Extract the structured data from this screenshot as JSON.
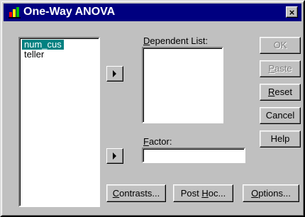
{
  "window": {
    "title": "One-Way ANOVA",
    "close_label": "×"
  },
  "variables": {
    "items": [
      {
        "label": "num_cus",
        "selected": true
      },
      {
        "label": "teller",
        "selected": false
      }
    ]
  },
  "dependent_list": {
    "label_prefix": "",
    "label_hotkey": "D",
    "label_rest": "ependent List:"
  },
  "factor": {
    "label_hotkey": "F",
    "label_rest": "actor:",
    "value": ""
  },
  "buttons": {
    "ok": "OK",
    "paste_hotkey": "P",
    "paste_rest": "aste",
    "reset_hotkey": "R",
    "reset_rest": "eset",
    "cancel": "Cancel",
    "help": "Help",
    "contrasts_hotkey": "C",
    "contrasts_rest": "ontrasts...",
    "posthoc_prefix": "Post ",
    "posthoc_hotkey": "H",
    "posthoc_rest": "oc...",
    "options_hotkey": "O",
    "options_rest": "ptions..."
  }
}
